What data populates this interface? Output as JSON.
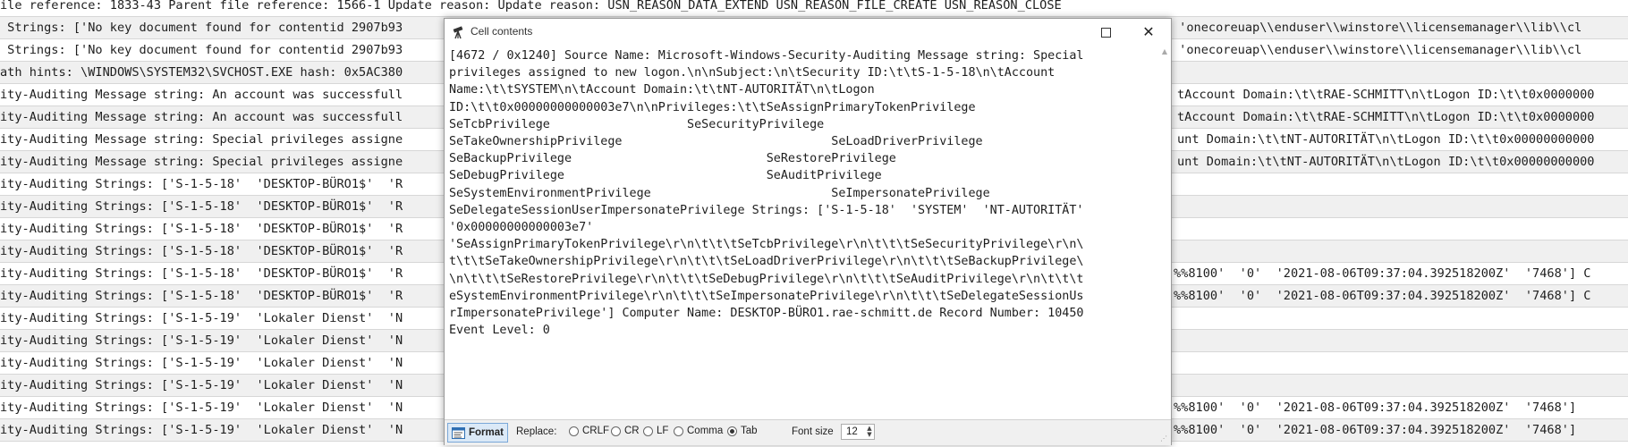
{
  "background_rows": [
    {
      "left": "ile reference: 1833-43 Parent file reference: 1566-1 Update reason: Update reason: USN_REASON_DATA_EXTEND USN_REASON_FILE_CREATE USN_REASON_CLOSE",
      "right": ""
    },
    {
      "left": " Strings: ['No key document found for contentid 2907b93",
      "right": " 'onecoreuap\\\\enduser\\\\winstore\\\\licensemanager\\\\lib\\\\cl"
    },
    {
      "left": " Strings: ['No key document found for contentid 2907b93",
      "right": " 'onecoreuap\\\\enduser\\\\winstore\\\\licensemanager\\\\lib\\\\cl"
    },
    {
      "left": "ath hints: \\WINDOWS\\SYSTEM32\\SVCHOST.EXE hash: 0x5AC380",
      "right": ""
    },
    {
      "left": "ity-Auditing Message string: An account was successfull",
      "right": "tAccount Domain:\\t\\tRAE-SCHMITT\\n\\tLogon ID:\\t\\t0x0000000"
    },
    {
      "left": "ity-Auditing Message string: An account was successfull",
      "right": "tAccount Domain:\\t\\tRAE-SCHMITT\\n\\tLogon ID:\\t\\t0x0000000"
    },
    {
      "left": "ity-Auditing Message string: Special privileges assigne",
      "right": "unt Domain:\\t\\tNT-AUTORITÄT\\n\\tLogon ID:\\t\\t0x00000000000"
    },
    {
      "left": "ity-Auditing Message string: Special privileges assigne",
      "right": "unt Domain:\\t\\tNT-AUTORITÄT\\n\\tLogon ID:\\t\\t0x00000000000"
    },
    {
      "left": "ity-Auditing Strings: ['S-1-5-18'  'DESKTOP-BÜRO1$'  'R",
      "right": ""
    },
    {
      "left": "ity-Auditing Strings: ['S-1-5-18'  'DESKTOP-BÜRO1$'  'R",
      "right": ""
    },
    {
      "left": "ity-Auditing Strings: ['S-1-5-18'  'DESKTOP-BÜRO1$'  'R",
      "right": ""
    },
    {
      "left": "ity-Auditing Strings: ['S-1-5-18'  'DESKTOP-BÜRO1$'  'R",
      "right": ""
    },
    {
      "left": "ity-Auditing Strings: ['S-1-5-18'  'DESKTOP-BÜRO1$'  'R",
      "right": "%%8100'  '0'  '2021-08-06T09:37:04.392518200Z'  '7468'] C"
    },
    {
      "left": "ity-Auditing Strings: ['S-1-5-18'  'DESKTOP-BÜRO1$'  'R",
      "right": "%%8100'  '0'  '2021-08-06T09:37:04.392518200Z'  '7468'] C"
    },
    {
      "left": "ity-Auditing Strings: ['S-1-5-19'  'Lokaler Dienst'  'N",
      "right": ""
    },
    {
      "left": "ity-Auditing Strings: ['S-1-5-19'  'Lokaler Dienst'  'N",
      "right": ""
    },
    {
      "left": "ity-Auditing Strings: ['S-1-5-19'  'Lokaler Dienst'  'N",
      "right": ""
    },
    {
      "left": "ity-Auditing Strings: ['S-1-5-19'  'Lokaler Dienst'  'N",
      "right": ""
    },
    {
      "left": "ity-Auditing Strings: ['S-1-5-19'  'Lokaler Dienst'  'N",
      "right": "%%8100'  '0'  '2021-08-06T09:37:04.392518200Z'  '7468']"
    },
    {
      "left": "ity-Auditing Strings: ['S-1-5-19'  'Lokaler Dienst'  'N",
      "right": "%%8100'  '0'  '2021-08-06T09:37:04.392518200Z'  '7468']"
    }
  ],
  "dialog": {
    "title": "Cell contents",
    "content": "[4672 / 0x1240] Source Name: Microsoft-Windows-Security-Auditing Message string: Special\nprivileges assigned to new logon.\\n\\nSubject:\\n\\tSecurity ID:\\t\\tS-1-5-18\\n\\tAccount\nName:\\t\\tSYSTEM\\n\\tAccount Domain:\\t\\tNT-AUTORITÄT\\n\\tLogon\nID:\\t\\t0x00000000000003e7\\n\\nPrivileges:\\t\\tSeAssignPrimaryTokenPrivilege\nSeTcbPrivilege                   SeSecurityPrivilege\nSeTakeOwnershipPrivilege                             SeLoadDriverPrivilege\nSeBackupPrivilege                           SeRestorePrivilege\nSeDebugPrivilege                            SeAuditPrivilege\nSeSystemEnvironmentPrivilege                         SeImpersonatePrivilege\nSeDelegateSessionUserImpersonatePrivilege Strings: ['S-1-5-18'  'SYSTEM'  'NT-AUTORITÄT'\n'0x00000000000003e7'\n'SeAssignPrimaryTokenPrivilege\\r\\n\\t\\t\\tSeTcbPrivilege\\r\\n\\t\\t\\tSeSecurityPrivilege\\r\\n\\\nt\\t\\tSeTakeOwnershipPrivilege\\r\\n\\t\\t\\tSeLoadDriverPrivilege\\r\\n\\t\\t\\tSeBackupPrivilege\\\n\\n\\t\\t\\tSeRestorePrivilege\\r\\n\\t\\t\\tSeDebugPrivilege\\r\\n\\t\\t\\tSeAuditPrivilege\\r\\n\\t\\t\\t\neSystemEnvironmentPrivilege\\r\\n\\t\\t\\tSeImpersonatePrivilege\\r\\n\\t\\t\\tSeDelegateSessionUs\nrImpersonatePrivilege'] Computer Name: DESKTOP-BÜRO1.rae-schmitt.de Record Number: 10450\nEvent Level: 0",
    "format_label": "Format",
    "replace_label": "Replace:",
    "replace_options": [
      {
        "label": "CRLF",
        "selected": false
      },
      {
        "label": "CR",
        "selected": false
      },
      {
        "label": "LF",
        "selected": false
      },
      {
        "label": "Comma",
        "selected": false
      },
      {
        "label": "Tab",
        "selected": true
      }
    ],
    "font_size_label": "Font size",
    "font_size_value": "12"
  }
}
